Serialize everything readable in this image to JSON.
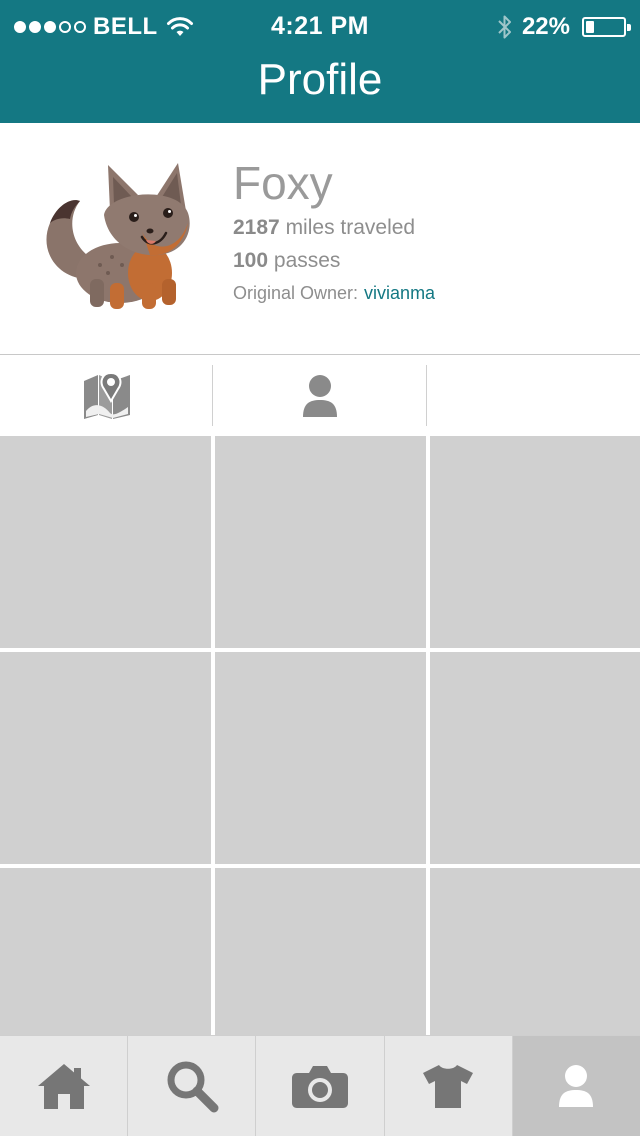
{
  "status_bar": {
    "carrier": "BELL",
    "time": "4:21 PM",
    "battery_text": "22%",
    "battery_level": 0.22,
    "signal_bars_filled": 3,
    "signal_bars_total": 5,
    "icons": [
      "wifi-icon",
      "bluetooth-icon",
      "battery-icon"
    ]
  },
  "header": {
    "title": "Profile"
  },
  "profile": {
    "name": "Foxy",
    "miles_value": "2187",
    "miles_label": "miles traveled",
    "passes_value": "100",
    "passes_label": "passes",
    "owner_label": "Original Owner:",
    "owner_name": "vivianma"
  },
  "tabs": [
    {
      "icon": "map-pin-icon"
    },
    {
      "icon": "person-icon"
    },
    {
      "icon": ""
    }
  ],
  "grid": {
    "cells": 9
  },
  "tabbar": {
    "items": [
      {
        "icon": "home-icon",
        "active": false
      },
      {
        "icon": "search-icon",
        "active": false
      },
      {
        "icon": "camera-icon",
        "active": false
      },
      {
        "icon": "shirt-icon",
        "active": false
      },
      {
        "icon": "person-icon",
        "active": true
      }
    ]
  },
  "colors": {
    "accent": "#147883",
    "grid_cell": "#d0d0d0",
    "tabbar_bg": "#e8e8e8",
    "tabbar_active": "#c3c3c3",
    "icon_gray": "#7a7a7a"
  }
}
